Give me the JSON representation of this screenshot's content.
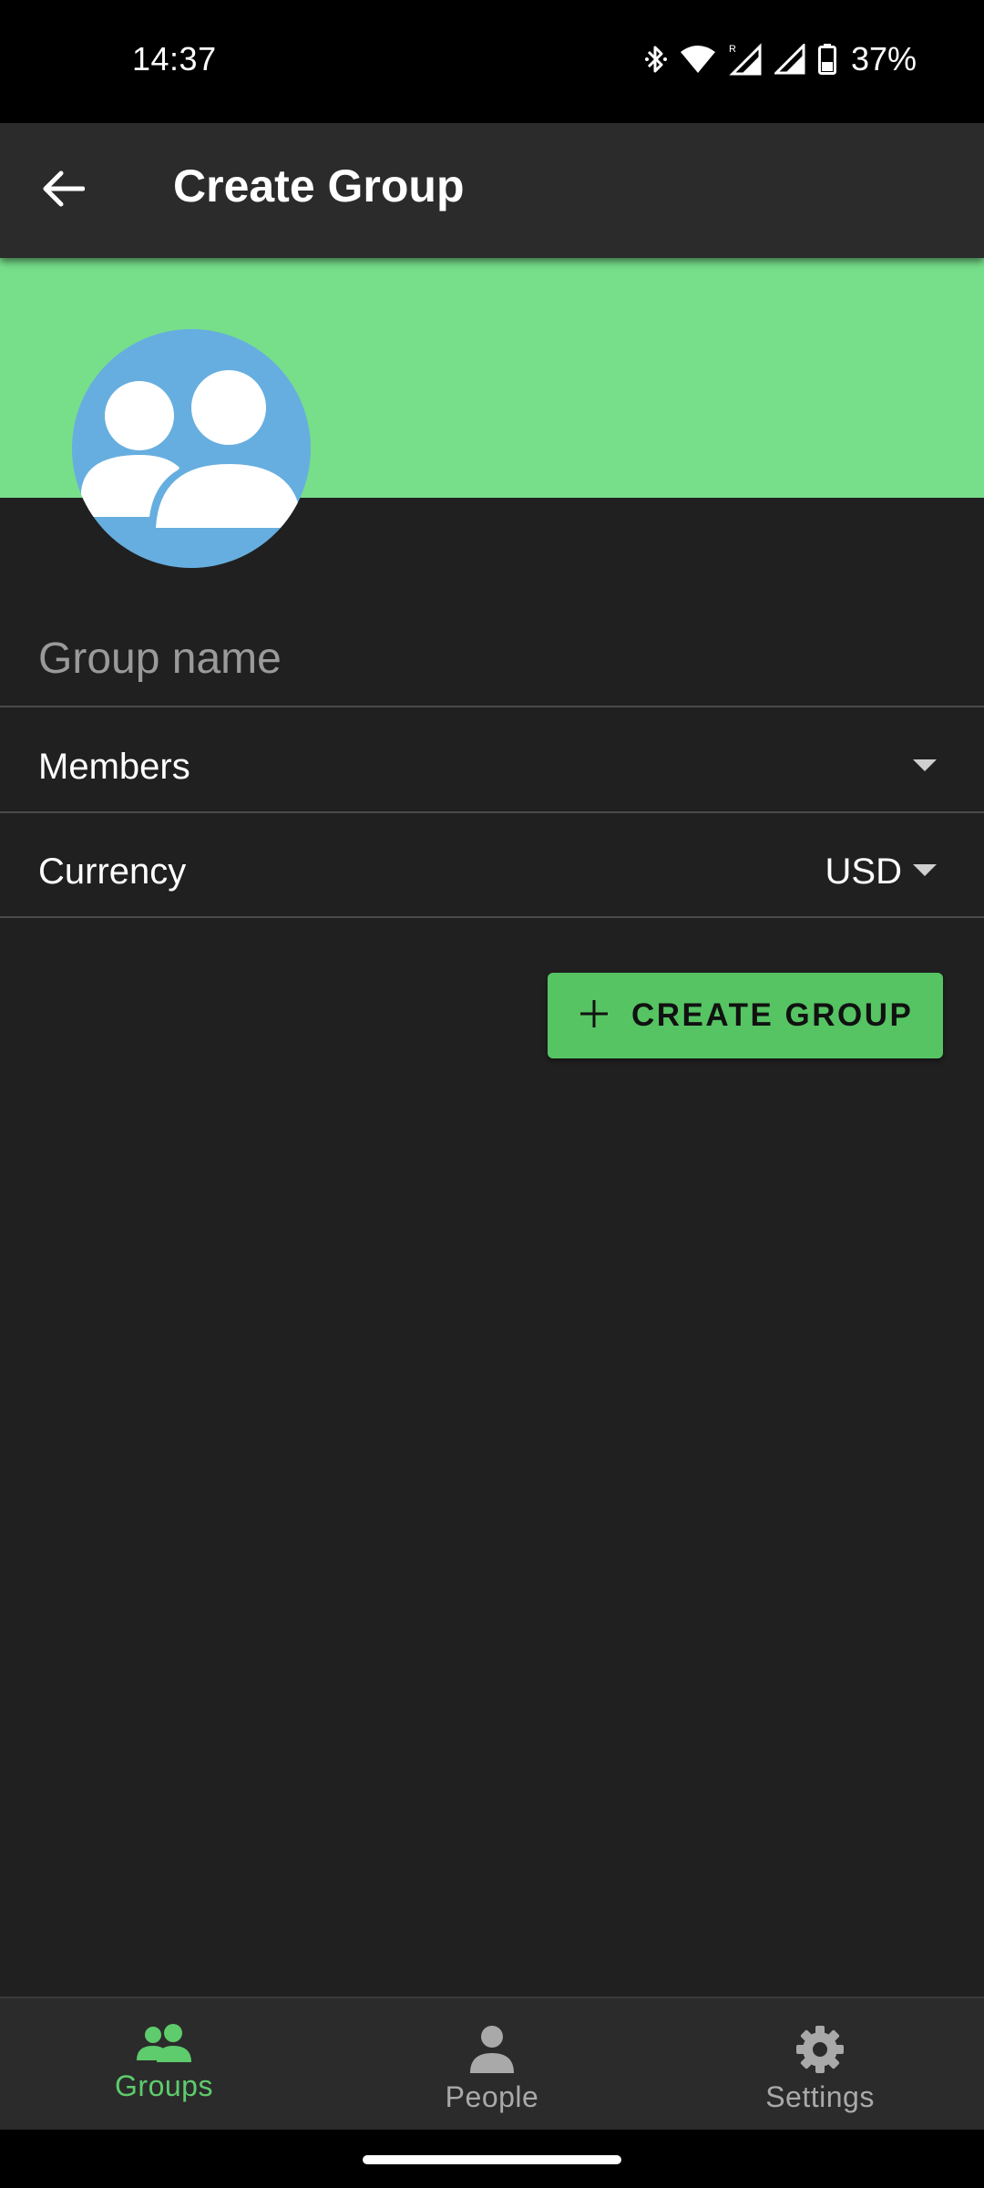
{
  "status_bar": {
    "time": "14:37",
    "battery": "37%",
    "icons": [
      "bluetooth-icon",
      "wifi-icon",
      "signal-roaming-icon",
      "signal-icon",
      "battery-icon"
    ]
  },
  "app_bar": {
    "title": "Create Group",
    "back_icon": "arrow-left-icon"
  },
  "header": {
    "banner_color": "#77df8a",
    "avatar_color": "#66aedf",
    "avatar_icon": "group-people-icon"
  },
  "form": {
    "group_name": {
      "placeholder": "Group name",
      "value": ""
    },
    "members": {
      "label": "Members",
      "value": ""
    },
    "currency": {
      "label": "Currency",
      "value": "USD"
    }
  },
  "actions": {
    "create_label": "CREATE GROUP",
    "create_icon": "plus-icon",
    "accent": "#56c463"
  },
  "bottom_nav": {
    "items": [
      {
        "label": "Groups",
        "icon": "groups-icon",
        "active": true
      },
      {
        "label": "People",
        "icon": "person-icon",
        "active": false
      },
      {
        "label": "Settings",
        "icon": "gear-icon",
        "active": false
      }
    ],
    "active_color": "#5ecb6c",
    "inactive_color": "#a9a9a9"
  }
}
